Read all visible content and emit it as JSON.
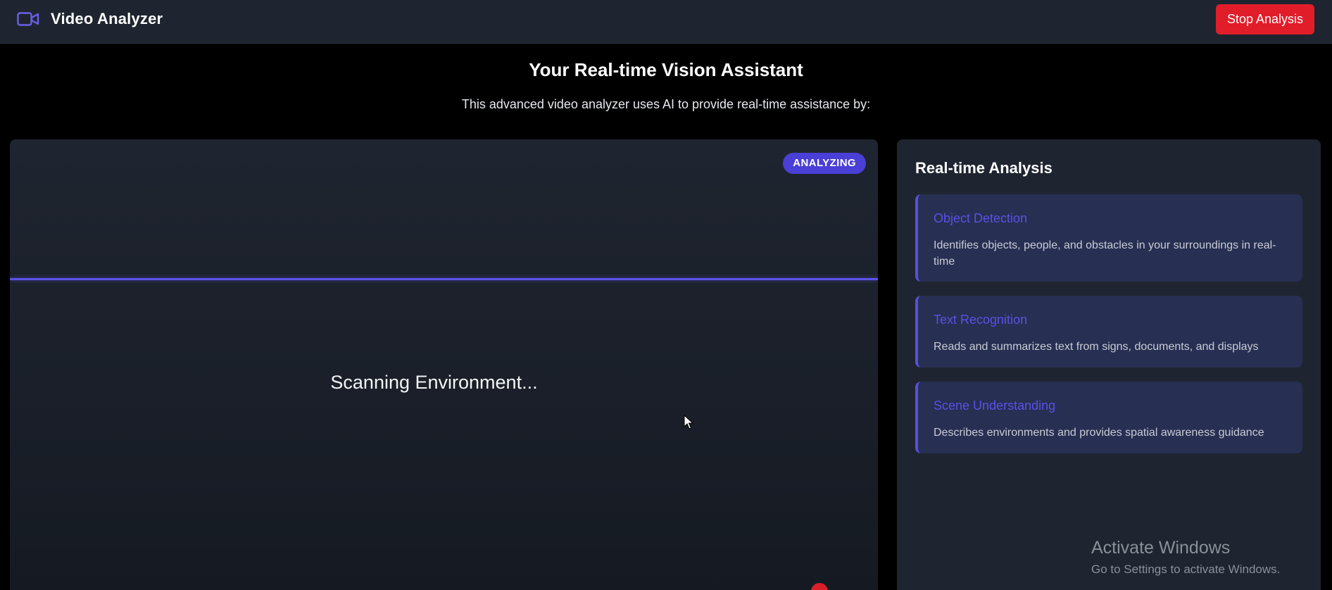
{
  "header": {
    "app_title": "Video Analyzer",
    "app_icon": "video-camera-icon",
    "stop_label": "Stop Analysis"
  },
  "hero": {
    "title": "Your Real-time Vision Assistant",
    "subtitle": "This advanced video analyzer uses AI to provide real-time assistance by:"
  },
  "video": {
    "status_badge": "ANALYZING",
    "scan_text": "Scanning Environment..."
  },
  "analysis": {
    "title": "Real-time Analysis",
    "features": [
      {
        "name": "Object Detection",
        "description": "Identifies objects, people, and obstacles in your surroundings in real-time"
      },
      {
        "name": "Text Recognition",
        "description": "Reads and summarizes text from signs, documents, and displays"
      },
      {
        "name": "Scene Understanding",
        "description": "Describes environments and provides spatial awareness guidance"
      }
    ]
  },
  "watermark": {
    "title": "Activate Windows",
    "subtitle": "Go to Settings to activate Windows."
  },
  "colors": {
    "accent": "#5b50e6",
    "danger": "#e11d2a",
    "panel": "#1e2530",
    "card": "#272f52"
  }
}
